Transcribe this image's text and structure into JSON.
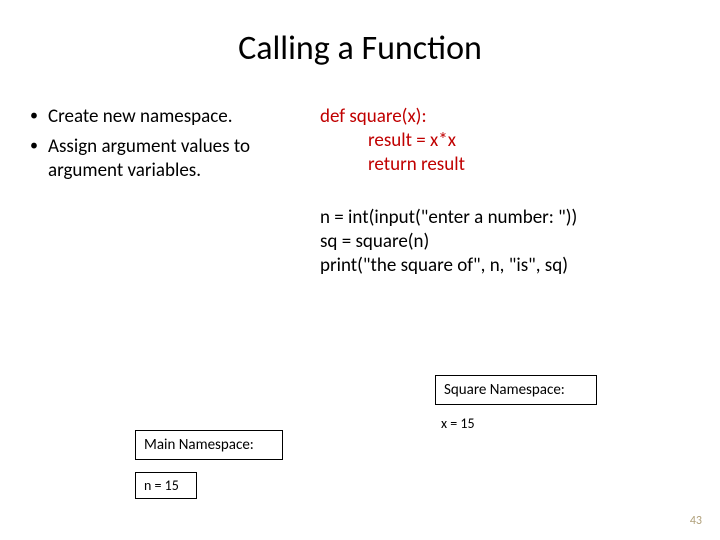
{
  "title": "Calling a Function",
  "bullets": [
    "Create new namespace.",
    "Assign argument values to argument variables."
  ],
  "code_def": {
    "line1": "def square(x):",
    "line2": "result = x*x",
    "line3": "return result"
  },
  "code_main": {
    "line1": "n = int(input(\"enter a number: \"))",
    "line2": "sq = square(n)",
    "line3": "print(\"the square of\", n, \"is\", sq)"
  },
  "ns_square": {
    "title": "Square Namespace:",
    "var": "x = 15"
  },
  "ns_main": {
    "title": "Main Namespace:",
    "var": "n = 15"
  },
  "page_number": "43"
}
